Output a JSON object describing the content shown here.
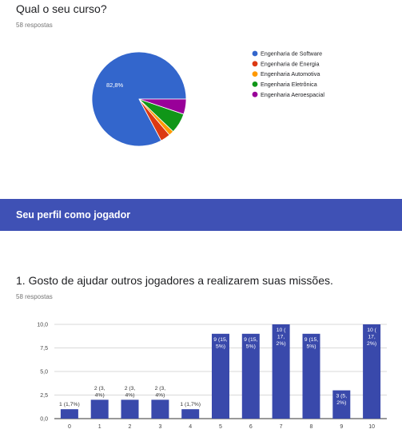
{
  "q1": {
    "title": "Qual o seu curso?",
    "responses": "58 respostas"
  },
  "section": {
    "title": "Seu perfil como jogador"
  },
  "q2": {
    "title": "1. Gosto de ajudar outros jogadores a realizarem suas missões.",
    "responses": "58 respostas"
  },
  "chart_data": [
    {
      "type": "pie",
      "title": "",
      "legend_position": "right",
      "slices": [
        {
          "label": "Engenharia de Software",
          "value": 82.8,
          "color": "#3366cc",
          "data_label": "82,8%"
        },
        {
          "label": "Engenharia de Energia",
          "value": 3.4,
          "color": "#dc3912",
          "data_label": ""
        },
        {
          "label": "Engenharia Automotiva",
          "value": 1.7,
          "color": "#ff9900",
          "data_label": ""
        },
        {
          "label": "Engenharia Eletrônica",
          "value": 6.9,
          "color": "#109618",
          "data_label": ""
        },
        {
          "label": "Engenharia Aeroespacial",
          "value": 5.2,
          "color": "#990099",
          "data_label": ""
        }
      ]
    },
    {
      "type": "bar",
      "title": "",
      "xlabel": "",
      "ylabel": "",
      "ylim": [
        0,
        10
      ],
      "y_ticks": [
        "0,0",
        "2,5",
        "5,0",
        "7,5",
        "10,0"
      ],
      "grid": true,
      "bar_color": "#3949ab",
      "categories": [
        "0",
        "1",
        "2",
        "3",
        "4",
        "5",
        "6",
        "7",
        "8",
        "9",
        "10"
      ],
      "values": [
        1,
        2,
        2,
        2,
        1,
        9,
        9,
        10,
        9,
        3,
        10
      ],
      "labels": [
        [
          "1 (1,7%)"
        ],
        [
          "2 (3,",
          "4%)"
        ],
        [
          "2 (3,",
          "4%)"
        ],
        [
          "2 (3,",
          "4%)"
        ],
        [
          "1 (1,7%)"
        ],
        [
          "9 (15,",
          "5%)"
        ],
        [
          "9 (15,",
          "5%)"
        ],
        [
          "10 (",
          "17,",
          "2%)"
        ],
        [
          "9 (15,",
          "5%)"
        ],
        [
          "3 (5,",
          "2%)"
        ],
        [
          "10 (",
          "17,",
          "2%)"
        ]
      ]
    }
  ]
}
